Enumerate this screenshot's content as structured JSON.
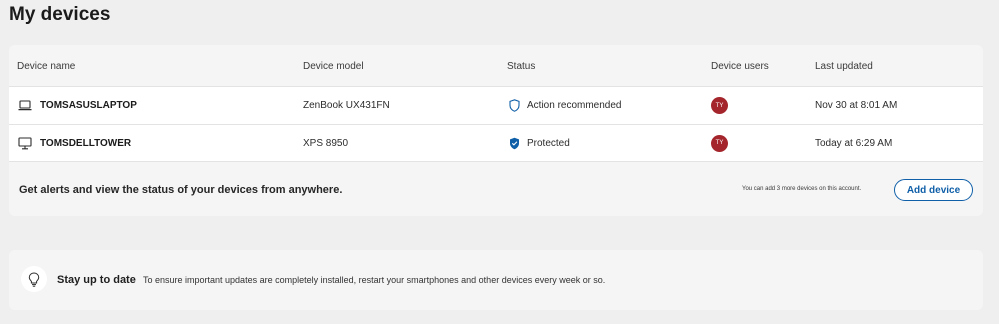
{
  "page": {
    "title": "My devices"
  },
  "table": {
    "headers": {
      "name": "Device name",
      "model": "Device model",
      "status": "Status",
      "users": "Device users",
      "updated": "Last updated"
    },
    "rows": [
      {
        "device_icon": "laptop-icon",
        "name": "TOMSASUSLAPTOP",
        "model": "ZenBook UX431FN",
        "status_icon": "shield-outline-icon",
        "status": "Action recommended",
        "user_initials": "TY",
        "updated": "Nov 30 at 8:01 AM"
      },
      {
        "device_icon": "desktop-monitor-icon",
        "name": "TOMSDELLTOWER",
        "model": "XPS 8950",
        "status_icon": "shield-check-icon",
        "status": "Protected",
        "user_initials": "TY",
        "updated": "Today at 6:29 AM"
      }
    ]
  },
  "footer": {
    "message": "Get alerts and view the status of your devices from anywhere.",
    "limit_note": "You can add 3 more devices on this account.",
    "add_button": "Add device"
  },
  "tip": {
    "icon": "lightbulb-icon",
    "title": "Stay up to date",
    "body": "To ensure important updates are completely installed, restart your smartphones and other devices every week or so."
  },
  "colors": {
    "accent": "#0f5fa8",
    "avatar": "#a4262c",
    "background": "#efeff0",
    "card": "#f5f5f6"
  }
}
